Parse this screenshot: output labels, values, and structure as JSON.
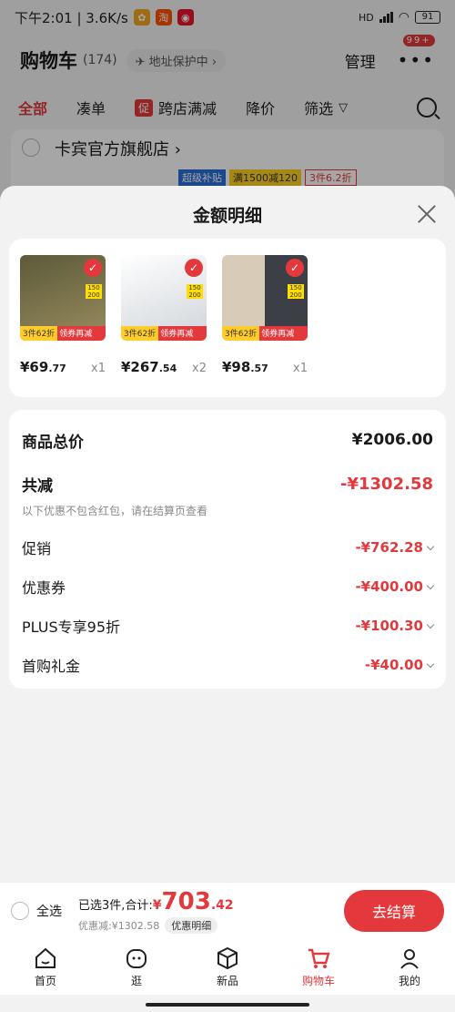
{
  "status": {
    "time_network": "下午2:01 | 3.6K/s",
    "apps": [
      {
        "icon": "game-app-icon",
        "color": "#f5a623",
        "glyph": "✿"
      },
      {
        "icon": "taobao-app-icon",
        "color": "#ff5000",
        "glyph": "淘"
      },
      {
        "icon": "weibo-app-icon",
        "color": "#e6162d",
        "glyph": "◉"
      }
    ],
    "hd": "HD",
    "battery": "91"
  },
  "cart": {
    "title": "购物车",
    "count": "(174)",
    "address_pill": "✈ 地址保护中 ›",
    "manage": "管理",
    "more_badge": "99+",
    "tabs": [
      "全部",
      "凑单",
      "跨店满减",
      "降价",
      "筛选"
    ],
    "promo_chip": "促",
    "store_name": "卡宾官方旗舰店",
    "store_tags": [
      "超级补贴",
      "满1500减120",
      "3件6.2折"
    ]
  },
  "sheet": {
    "title": "金额明细",
    "products": [
      {
        "price_int": "¥69",
        "price_dec": ".77",
        "qty": "x1",
        "promo_left": "3件62折",
        "promo_right": "领券再减260元",
        "colors": [
          "#5b5a3a",
          "#9a8c5e"
        ]
      },
      {
        "price_int": "¥267",
        "price_dec": ".54",
        "qty": "x2",
        "promo_left": "3件62折",
        "promo_right": "领券再减260元",
        "colors": [
          "#e9ecef",
          "#cfd4d9"
        ]
      },
      {
        "price_int": "¥98",
        "price_dec": ".57",
        "qty": "x1",
        "promo_left": "3件62折",
        "promo_right": "领券再减260元",
        "colors": [
          "#d8cbb8",
          "#3c4046"
        ]
      }
    ],
    "total_label": "商品总价",
    "total_value": "¥2006.00",
    "reduce_label": "共减",
    "reduce_value": "-¥1302.58",
    "reduce_note": "以下优惠不包含红包，请在结算页查看",
    "items": [
      {
        "label": "促销",
        "value": "-¥762.28"
      },
      {
        "label": "优惠券",
        "value": "-¥400.00"
      },
      {
        "label": "PLUS专享95折",
        "value": "-¥100.30"
      },
      {
        "label": "首购礼金",
        "value": "-¥40.00"
      }
    ]
  },
  "checkout": {
    "select_all": "全选",
    "selected_text": "已选3件,合计:",
    "yen": "¥",
    "total_int": "703",
    "total_dec": ".42",
    "discount_text": "优惠减:¥1302.58",
    "detail_pill": "优惠明细",
    "button": "去结算"
  },
  "tabbar": [
    {
      "label": "首页",
      "icon": "home-icon"
    },
    {
      "label": "逛",
      "icon": "discover-icon"
    },
    {
      "label": "新品",
      "icon": "box-icon"
    },
    {
      "label": "购物车",
      "icon": "cart-icon"
    },
    {
      "label": "我的",
      "icon": "profile-icon"
    }
  ],
  "colors": {
    "accent": "#e4393c"
  }
}
